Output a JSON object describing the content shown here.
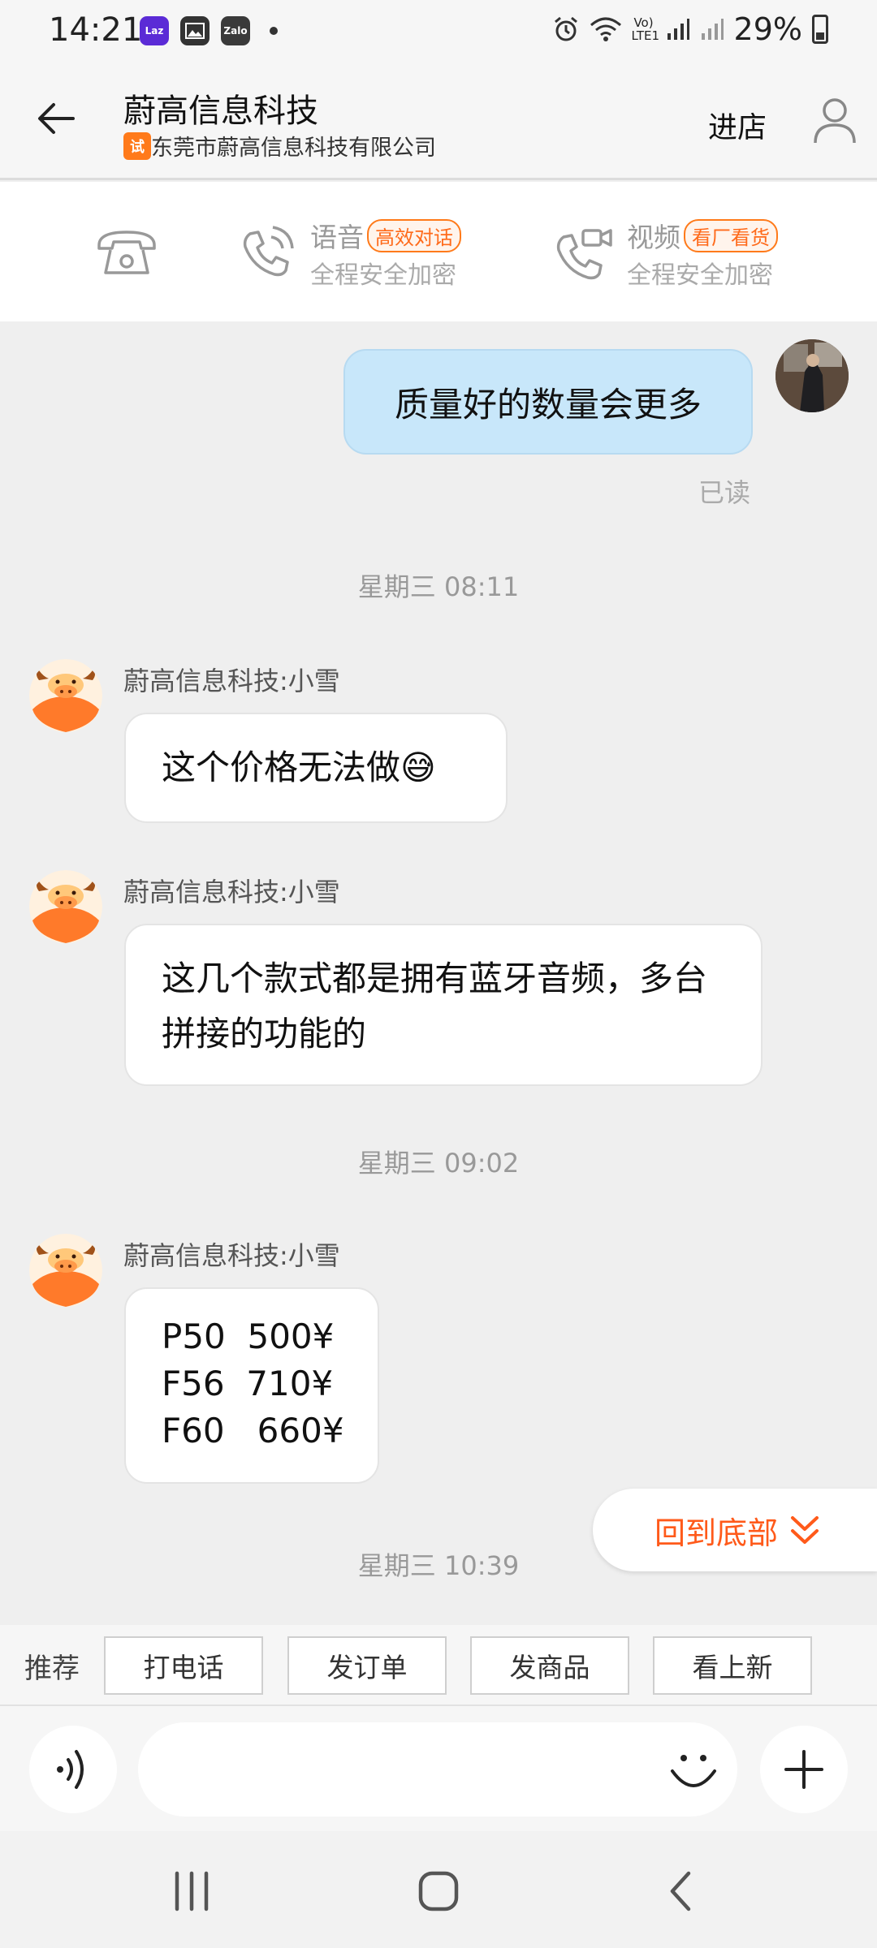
{
  "status_bar": {
    "time": "14:21",
    "apps": [
      {
        "name": "lazada-icon",
        "label": "Laz",
        "color": "#5b2bd6"
      },
      {
        "name": "gallery-icon",
        "label": "",
        "color": "#333333"
      },
      {
        "name": "zalo-icon",
        "label": "Zalo",
        "color": "#3a3a3a"
      }
    ],
    "network_label": "Vo) LTE1",
    "battery": "29%"
  },
  "header": {
    "title": "蔚高信息科技",
    "subtitle": "东莞市蔚高信息科技有限公司",
    "shop_badge": "试",
    "enter_shop": "进店"
  },
  "call_bar": {
    "voice": {
      "label": "语音",
      "tag": "高效对话",
      "sub": "全程安全加密"
    },
    "video": {
      "label": "视频",
      "tag": "看厂看货",
      "sub": "全程安全加密"
    }
  },
  "chat": {
    "my_message": "质量好的数量会更多",
    "read_status": "已读",
    "time_1": "星期三 08:11",
    "time_2": "星期三 09:02",
    "time_3": "星期三 10:39",
    "messages": [
      {
        "sender": "蔚高信息科技:小雪",
        "text": "这个价格无法做😅"
      },
      {
        "sender": "蔚高信息科技:小雪",
        "text": "这几个款式都是拥有蓝牙音频，多台拼接的功能的"
      },
      {
        "sender": "蔚高信息科技:小雪",
        "text": "P50  500¥\nF56  710¥\nF60   660¥"
      }
    ],
    "back_to_bottom": "回到底部"
  },
  "quick_actions": {
    "label": "推荐",
    "buttons": [
      "打电话",
      "发订单",
      "发商品",
      "看上新"
    ]
  },
  "input": {
    "placeholder": "",
    "value": ""
  },
  "colors": {
    "accent": "#ff6a1a",
    "my_bubble": "#c8e7fa",
    "background": "#efefef"
  }
}
